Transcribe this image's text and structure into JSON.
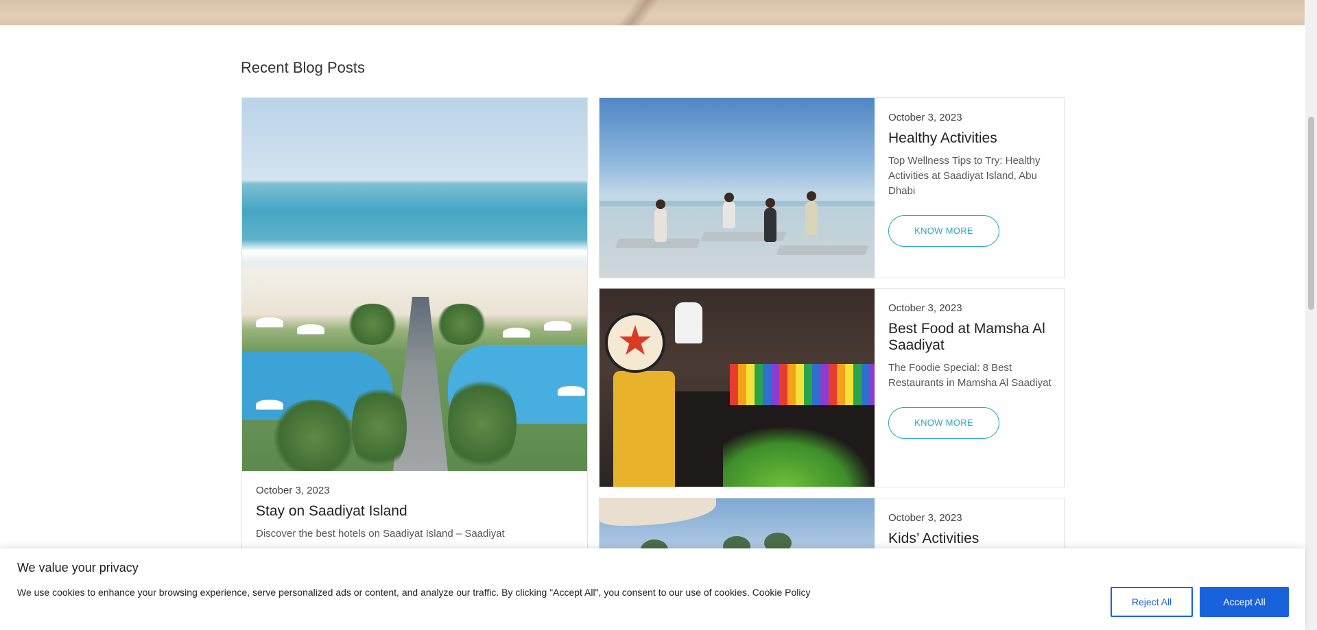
{
  "section": {
    "title": "Recent Blog Posts"
  },
  "posts": [
    {
      "date": "October 3, 2023",
      "title": "Stay on Saadiyat Island",
      "excerpt": "Discover the best hotels on Saadiyat Island – Saadiyat"
    },
    {
      "date": "October 3, 2023",
      "title": "Healthy Activities",
      "excerpt": "Top Wellness Tips to Try: Healthy Activities at Saadiyat Island, Abu Dhabi",
      "button": "KNOW MORE"
    },
    {
      "date": "October 3, 2023",
      "title": "Best Food at Mamsha Al Saadiyat",
      "excerpt": "The Foodie Special: 8 Best Restaurants in Mamsha Al Saadiyat",
      "button": "KNOW MORE"
    },
    {
      "date": "October 3, 2023",
      "title": "Kids’ Activities"
    }
  ],
  "cookie": {
    "title": "We value your privacy",
    "text": "We use cookies to enhance your browsing experience, serve personalized ads or content, and analyze our traffic. By clicking \"Accept All\", you consent to our use of cookies.",
    "link": "Cookie Policy",
    "reject": "Reject All",
    "accept": "Accept All"
  },
  "colors": {
    "accent": "#2aa6c8",
    "cookie_button": "#1863dc"
  }
}
